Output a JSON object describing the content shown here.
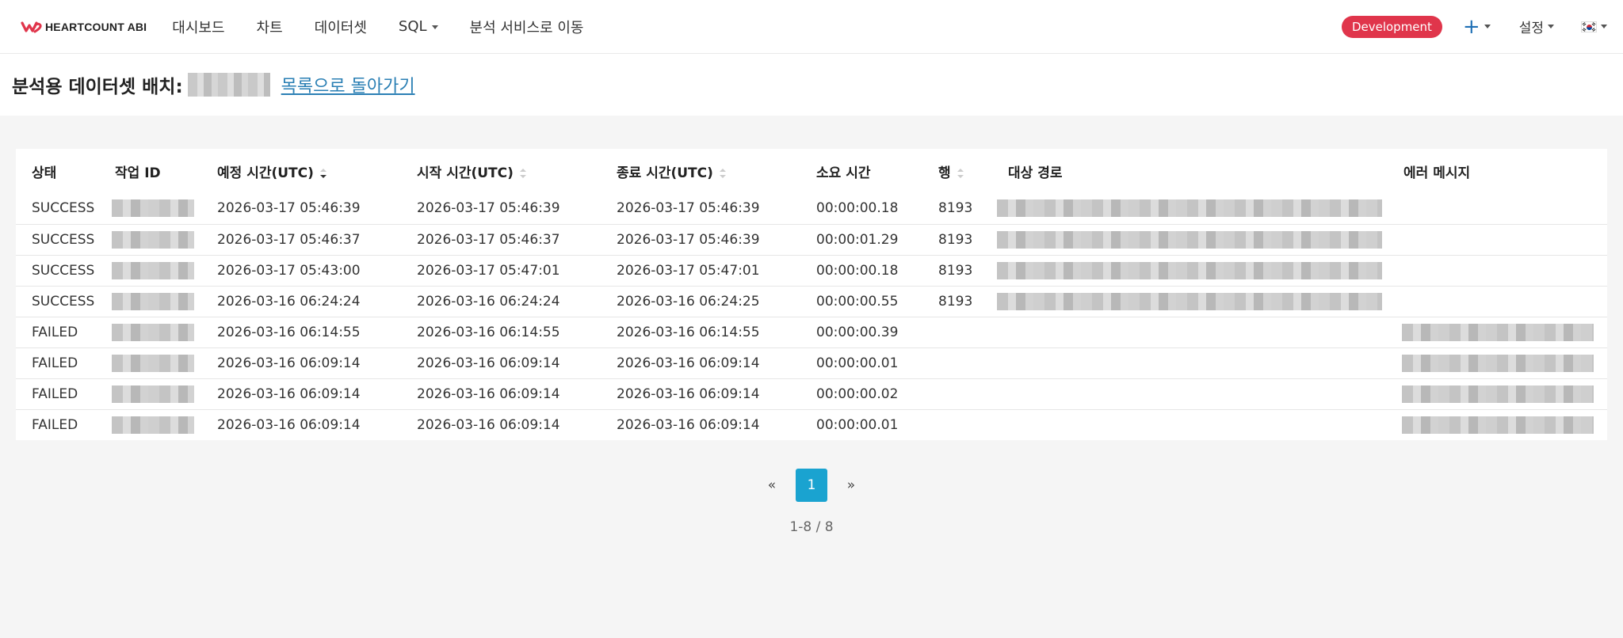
{
  "nav": {
    "brand": "HEARTCOUNT ABI",
    "menu": [
      "대시보드",
      "차트",
      "데이터셋",
      "SQL",
      "분석 서비스로 이동"
    ],
    "env_badge": "Development",
    "add_label": "+",
    "settings": "설정",
    "colors": {
      "accent": "#1aa3d0",
      "badge": "#e0354b",
      "link": "#2a7fb4"
    }
  },
  "header": {
    "title": "분석용 데이터셋 배치:",
    "back_link": "목록으로 돌아가기"
  },
  "table": {
    "columns": [
      "상태",
      "작업 ID",
      "예정 시간(UTC)",
      "시작 시간(UTC)",
      "종료 시간(UTC)",
      "소요 시간",
      "행",
      "대상 경로",
      "에러 메시지"
    ],
    "rows": [
      {
        "status": "SUCCESS",
        "scheduled": "2026-03-17 05:46:39",
        "start": "2026-03-17 05:46:39",
        "end": "2026-03-17 05:46:39",
        "duration": "00:00:00.18",
        "rows": "8193"
      },
      {
        "status": "SUCCESS",
        "scheduled": "2026-03-17 05:46:37",
        "start": "2026-03-17 05:46:37",
        "end": "2026-03-17 05:46:39",
        "duration": "00:00:01.29",
        "rows": "8193"
      },
      {
        "status": "SUCCESS",
        "scheduled": "2026-03-17 05:43:00",
        "start": "2026-03-17 05:47:01",
        "end": "2026-03-17 05:47:01",
        "duration": "00:00:00.18",
        "rows": "8193"
      },
      {
        "status": "SUCCESS",
        "scheduled": "2026-03-16 06:24:24",
        "start": "2026-03-16 06:24:24",
        "end": "2026-03-16 06:24:25",
        "duration": "00:00:00.55",
        "rows": "8193"
      },
      {
        "status": "FAILED",
        "scheduled": "2026-03-16 06:14:55",
        "start": "2026-03-16 06:14:55",
        "end": "2026-03-16 06:14:55",
        "duration": "00:00:00.39",
        "rows": ""
      },
      {
        "status": "FAILED",
        "scheduled": "2026-03-16 06:09:14",
        "start": "2026-03-16 06:09:14",
        "end": "2026-03-16 06:09:14",
        "duration": "00:00:00.01",
        "rows": ""
      },
      {
        "status": "FAILED",
        "scheduled": "2026-03-16 06:09:14",
        "start": "2026-03-16 06:09:14",
        "end": "2026-03-16 06:09:14",
        "duration": "00:00:00.02",
        "rows": ""
      },
      {
        "status": "FAILED",
        "scheduled": "2026-03-16 06:09:14",
        "start": "2026-03-16 06:09:14",
        "end": "2026-03-16 06:09:14",
        "duration": "00:00:00.01",
        "rows": ""
      }
    ]
  },
  "pagination": {
    "prev": "«",
    "current": "1",
    "next": "»",
    "count": "1-8 / 8"
  }
}
